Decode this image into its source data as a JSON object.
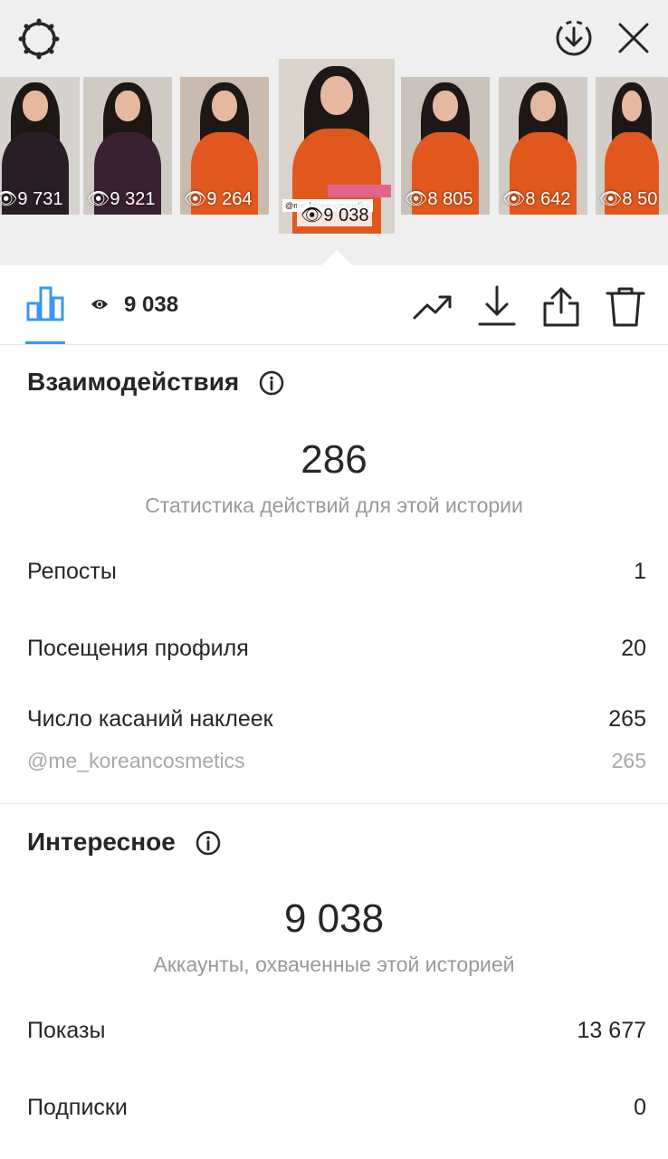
{
  "header": {
    "settings_icon": "gear-icon",
    "download_icon": "dashed-circle-download-icon",
    "close_icon": "close-icon"
  },
  "thumbnails": [
    {
      "views": "9 731",
      "outfit": "#2a1e26"
    },
    {
      "views": "9 321",
      "outfit": "#3a2030"
    },
    {
      "views": "9 264",
      "outfit": "#e0581e"
    },
    {
      "views": "9 038",
      "outfit": "#e0581e",
      "selected": true
    },
    {
      "views": "8 805",
      "outfit": "#e0581e"
    },
    {
      "views": "8 642",
      "outfit": "#e0581e"
    },
    {
      "views": "8 50",
      "outfit": "#e0581e"
    }
  ],
  "thumbnail_sticker": "@me_koreancosmetics",
  "toolbar": {
    "views_count": "9 038",
    "icons": [
      "bar-chart-icon",
      "eye-icon",
      "trend-icon",
      "download-icon",
      "share-icon",
      "trash-icon"
    ],
    "accent": "#3897f0"
  },
  "interactions": {
    "title": "Взаимодействия",
    "total": "286",
    "subtitle": "Статистика действий для этой истории",
    "rows": [
      {
        "label": "Репосты",
        "value": "1"
      },
      {
        "label": "Посещения профиля",
        "value": "20"
      },
      {
        "label": "Число касаний наклеек",
        "value": "265"
      }
    ],
    "sticker": {
      "label": "@me_koreancosmetics",
      "value": "265"
    }
  },
  "discovery": {
    "title": "Интересное",
    "total": "9 038",
    "subtitle": "Аккаунты, охваченные этой историей",
    "rows": [
      {
        "label": "Показы",
        "value": "13 677"
      },
      {
        "label": "Подписки",
        "value": "0"
      }
    ]
  }
}
